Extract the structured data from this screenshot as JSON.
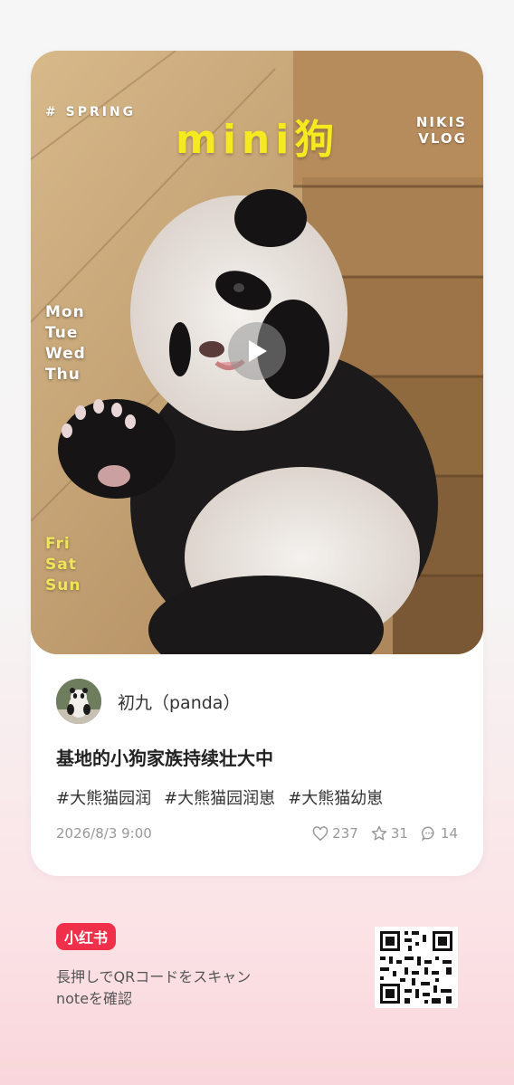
{
  "photo": {
    "tag": "# SPRING",
    "title": "mini狗",
    "brand_line1": "NIKIS",
    "brand_line2": "VLOG",
    "weekdays": [
      "Mon",
      "Tue",
      "Wed",
      "Thu"
    ],
    "weekend": [
      "Fri",
      "Sat",
      "Sun"
    ],
    "play_icon": "play-icon"
  },
  "author": {
    "name": "初九（panda）",
    "avatar_icon": "panda-avatar"
  },
  "post": {
    "title": "基地的小狗家族持续壮大中",
    "hashtags": [
      "#大熊猫园润",
      "#大熊猫园润崽",
      "#大熊猫幼崽"
    ],
    "date": "2026/8/3 9:00",
    "likes": "237",
    "favorites": "31",
    "comments": "14"
  },
  "footer": {
    "logo": "小红书",
    "line1": "長押しでQRコードをスキャン",
    "line2": "noteを確認"
  },
  "colors": {
    "title_yellow": "#f5ea20",
    "brand_red": "#f0304a"
  }
}
